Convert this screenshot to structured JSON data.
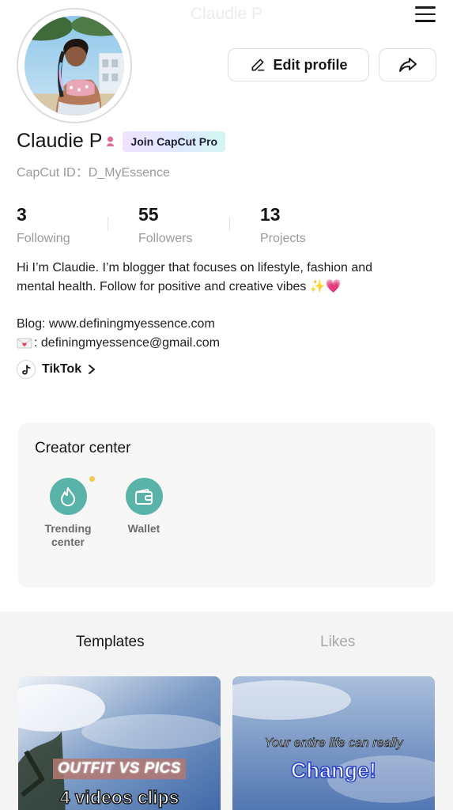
{
  "header": {
    "faded_title": "Claudie P"
  },
  "profile": {
    "name": "Claudie P",
    "pro_badge": "Join CapCut Pro",
    "id_text": "CapCut ID：D_MyEssence",
    "edit_label": "Edit profile"
  },
  "stats": [
    {
      "value": "3",
      "label": "Following"
    },
    {
      "value": "55",
      "label": "Followers"
    },
    {
      "value": "13",
      "label": "Projects"
    }
  ],
  "bio": {
    "line1": "Hi I’m Claudie. I’m blogger that focuses on lifestyle, fashion and",
    "line2": "mental health. Follow for positive and creative vibes ✨💗",
    "blog": "Blog: www.definingmyessence.com",
    "email": ": definingmyessence@gmail.com"
  },
  "links": {
    "tiktok_label": "TikTok"
  },
  "creator_center": {
    "title": "Creator center",
    "tools": [
      {
        "label": "Trending center",
        "line1": "Trending",
        "line2": "center"
      },
      {
        "label": "Wallet"
      }
    ]
  },
  "tabs": [
    {
      "label": "Templates",
      "active": true
    },
    {
      "label": "Likes",
      "active": false
    }
  ],
  "templates": [
    {
      "tag": "OUTFIT VS PICS",
      "headline": "4 videos clips"
    },
    {
      "subhead": "Your entire life can really",
      "headline": "Change!"
    }
  ],
  "colors": {
    "accent_teal": "#59b3a9",
    "notification_dot": "#f4c84b",
    "gender_icon": "#e26b8f"
  }
}
